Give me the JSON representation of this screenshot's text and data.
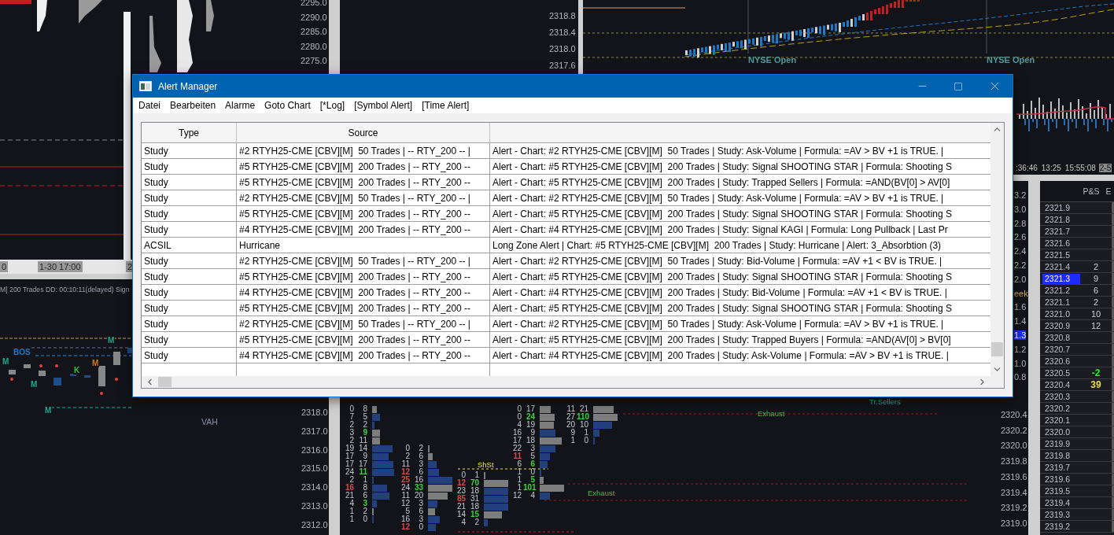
{
  "charts": {
    "top_left": {
      "price_axis": [
        "2295.0",
        "2290.0",
        "2285.0",
        "2280.0",
        "2275.0"
      ],
      "time_axis": [
        "0",
        "1-30 17:00",
        "2"
      ]
    },
    "top_middle": {
      "price_axis": [
        "2318.8",
        "2318.4",
        "2318.0",
        "2317.6"
      ]
    },
    "top_right": {
      "markers": [
        "NYSE Open",
        "NYSE Open"
      ],
      "time_axis": [
        ":36:46",
        "13:25",
        "15:55:08",
        "2-5"
      ]
    },
    "left_middle": {
      "header": "M] 200 Trades DD: 00:10:11(delayed) Sign",
      "labels": [
        {
          "text": "BOS",
          "color": "#1e78c8"
        },
        {
          "text": "M",
          "color": "#1aa88a"
        },
        {
          "text": "M",
          "color": "#1aa88a"
        },
        {
          "text": "M",
          "color": "#1aa88a"
        },
        {
          "text": "K",
          "color": "#32c832"
        },
        {
          "text": "M",
          "color": "#d2781e"
        },
        {
          "text": "M",
          "color": "#1aa88a"
        }
      ],
      "level_label": "VAH",
      "price_axis": [
        "2318.0",
        "2317.0",
        "2316.0",
        "2315.0",
        "2314.0",
        "2313.0",
        "2312.0"
      ]
    },
    "footprint": {
      "columns": [
        {
          "rows": [
            {
              "cells": [
                {
                  "text": "0"
                },
                {
                  "text": "8"
                }
              ]
            },
            {
              "cells": [
                {
                  "text": "7"
                },
                {
                  "text": "5"
                }
              ]
            },
            {
              "cells": [
                {
                  "text": "2"
                },
                {
                  "text": "2"
                }
              ]
            },
            {
              "cells": [
                {
                  "text": "3"
                },
                {
                  "text": "9",
                  "color": "#3cd23c"
                }
              ]
            },
            {
              "cells": [
                {
                  "text": "2"
                },
                {
                  "text": "11"
                }
              ]
            },
            {
              "cells": [
                {
                  "text": "19"
                },
                {
                  "text": "14"
                }
              ]
            },
            {
              "cells": [
                {
                  "text": "17"
                },
                {
                  "text": "9"
                }
              ]
            },
            {
              "cells": [
                {
                  "text": "17"
                },
                {
                  "text": "17"
                }
              ]
            },
            {
              "cells": [
                {
                  "text": "24"
                },
                {
                  "text": "11",
                  "color": "#3cd23c"
                }
              ]
            },
            {
              "cells": [
                {
                  "text": "2"
                },
                {
                  "text": "1"
                }
              ]
            },
            {
              "cells": [
                {
                  "text": "16",
                  "color": "#d94a4a"
                },
                {
                  "text": "8"
                }
              ]
            },
            {
              "cells": [
                {
                  "text": "21"
                },
                {
                  "text": "6"
                }
              ]
            },
            {
              "cells": [
                {
                  "text": "4"
                },
                {
                  "text": "3",
                  "color": "#3cd23c"
                }
              ]
            },
            {
              "cells": [
                {
                  "text": "1"
                },
                {
                  "text": "2"
                }
              ]
            },
            {
              "cells": [
                {
                  "text": "1"
                },
                {
                  "text": "0"
                }
              ]
            }
          ]
        },
        {
          "rows": [
            {
              "cells": [
                {
                  "text": "0"
                },
                {
                  "text": "2"
                }
              ]
            },
            {
              "cells": [
                {
                  "text": "2"
                },
                {
                  "text": "6"
                }
              ]
            },
            {
              "cells": [
                {
                  "text": "11"
                },
                {
                  "text": "3"
                }
              ]
            },
            {
              "cells": [
                {
                  "text": "12",
                  "color": "#d94a4a"
                },
                {
                  "text": "6"
                }
              ]
            },
            {
              "cells": [
                {
                  "text": "25",
                  "color": "#d94a4a"
                },
                {
                  "text": "16"
                }
              ]
            },
            {
              "cells": [
                {
                  "text": "24"
                },
                {
                  "text": "33",
                  "color": "#3cd23c"
                }
              ]
            },
            {
              "cells": [
                {
                  "text": "11"
                },
                {
                  "text": "20"
                }
              ]
            },
            {
              "cells": [
                {
                  "text": "12"
                },
                {
                  "text": "3"
                }
              ]
            },
            {
              "cells": [
                {
                  "text": "5"
                },
                {
                  "text": "6"
                }
              ]
            },
            {
              "cells": [
                {
                  "text": "16"
                },
                {
                  "text": "3"
                }
              ]
            },
            {
              "cells": [
                {
                  "text": "12",
                  "color": "#d94a4a"
                },
                {
                  "text": "0"
                }
              ]
            }
          ]
        },
        {
          "label": "ShSt",
          "rows": [
            {
              "cells": [
                {
                  "text": "0"
                },
                {
                  "text": "1"
                }
              ]
            },
            {
              "cells": [
                {
                  "text": "12",
                  "color": "#d94a4a"
                },
                {
                  "text": "70",
                  "color": "#3cd23c"
                }
              ]
            },
            {
              "cells": [
                {
                  "text": "23"
                },
                {
                  "text": "18"
                }
              ]
            },
            {
              "cells": [
                {
                  "text": "85",
                  "color": "#d94a4a"
                },
                {
                  "text": "31"
                }
              ]
            },
            {
              "cells": [
                {
                  "text": "21"
                },
                {
                  "text": "18"
                }
              ]
            },
            {
              "cells": [
                {
                  "text": "14"
                },
                {
                  "text": "15",
                  "color": "#3cd23c"
                }
              ]
            },
            {
              "cells": [
                {
                  "text": "4"
                },
                {
                  "text": "2"
                }
              ]
            }
          ]
        },
        {
          "rows": [
            {
              "cells": [
                {
                  "text": "0"
                },
                {
                  "text": "17"
                }
              ]
            },
            {
              "cells": [
                {
                  "text": "0"
                },
                {
                  "text": "24",
                  "color": "#3cd23c"
                }
              ]
            },
            {
              "cells": [
                {
                  "text": "4"
                },
                {
                  "text": "19"
                }
              ]
            },
            {
              "cells": [
                {
                  "text": "16"
                },
                {
                  "text": "9"
                }
              ]
            },
            {
              "cells": [
                {
                  "text": "17"
                },
                {
                  "text": "18"
                }
              ]
            },
            {
              "cells": [
                {
                  "text": "22"
                },
                {
                  "text": "3"
                }
              ]
            },
            {
              "cells": [
                {
                  "text": "11",
                  "color": "#d94a4a"
                },
                {
                  "text": "5"
                }
              ]
            },
            {
              "cells": [
                {
                  "text": "6"
                },
                {
                  "text": "6",
                  "color": "#3cd23c"
                }
              ]
            },
            {
              "cells": [
                {
                  "text": "1"
                },
                {
                  "text": "0"
                }
              ]
            },
            {
              "cells": [
                {
                  "text": "1"
                },
                {
                  "text": "5",
                  "color": "#3cd23c"
                }
              ]
            },
            {
              "cells": [
                {
                  "text": "1"
                },
                {
                  "text": "101",
                  "color": "#3cd23c"
                }
              ]
            },
            {
              "cells": [
                {
                  "text": "12"
                },
                {
                  "text": "4"
                }
              ]
            }
          ]
        },
        {
          "rows": [
            {
              "cells": [
                {
                  "text": "11"
                },
                {
                  "text": "21"
                }
              ]
            },
            {
              "cells": [
                {
                  "text": "27"
                },
                {
                  "text": "110",
                  "color": "#3cd23c"
                }
              ]
            },
            {
              "cells": [
                {
                  "text": "20"
                },
                {
                  "text": "10"
                }
              ]
            },
            {
              "cells": [
                {
                  "text": "9"
                },
                {
                  "text": "1"
                }
              ]
            },
            {
              "cells": [
                {
                  "text": "1"
                },
                {
                  "text": "0"
                }
              ]
            }
          ]
        }
      ],
      "labels": [
        "Exhaust",
        "Exhaust",
        "Tr.Sellers"
      ],
      "axis_tails": [
        {
          "text": "3.2",
          "highlighted": false
        },
        {
          "text": "3.0",
          "highlighted": false
        },
        {
          "text": "2.8",
          "highlighted": false
        },
        {
          "text": "2.6",
          "highlighted": false
        },
        {
          "text": "2.4",
          "highlighted": false
        },
        {
          "text": "2.2",
          "highlighted": false
        },
        {
          "text": "2.0",
          "highlighted": false
        },
        {
          "text": "eek",
          "highlighted": false
        },
        {
          "text": "1.6",
          "highlighted": false
        },
        {
          "text": "1.4",
          "highlighted": false
        },
        {
          "text": "1.3",
          "highlighted": true
        },
        {
          "text": "1.2",
          "highlighted": false
        },
        {
          "text": "1.0",
          "highlighted": false
        },
        {
          "text": "0.8",
          "highlighted": false
        }
      ],
      "price_axis": [
        "2320.4",
        "2320.2",
        "2320.0",
        "2319.8",
        "2319.6",
        "2319.4",
        "2319.2",
        "2319.0"
      ]
    },
    "dom": {
      "columns": [
        "P&S",
        "E"
      ],
      "rows": [
        {
          "price": "2321.9",
          "highlighted": false
        },
        {
          "price": "2321.8",
          "highlighted": false
        },
        {
          "price": "2321.7",
          "highlighted": false
        },
        {
          "price": "2321.6",
          "highlighted": false
        },
        {
          "price": "2321.5",
          "highlighted": false
        },
        {
          "price": "2321.4",
          "ps": "2",
          "highlighted": false
        },
        {
          "price": "2321.3",
          "ps": "9",
          "highlighted": true
        },
        {
          "price": "2321.2",
          "ps": "6",
          "highlighted": false
        },
        {
          "price": "2321.1",
          "ps": "2",
          "highlighted": false
        },
        {
          "price": "2321.0",
          "ps": "10",
          "highlighted": false
        },
        {
          "price": "2320.9",
          "ps": "12",
          "highlighted": false
        },
        {
          "price": "2320.8",
          "highlighted": false
        },
        {
          "price": "2320.7",
          "highlighted": false
        },
        {
          "price": "2320.6",
          "highlighted": false
        },
        {
          "price": "2320.5",
          "ps": "-2",
          "color": "#2ee82e",
          "highlighted": false
        },
        {
          "price": "2320.4",
          "ps": "39",
          "color": "#e8d84a",
          "highlighted": false
        },
        {
          "price": "2320.3",
          "highlighted": false
        },
        {
          "price": "2320.2",
          "highlighted": false
        },
        {
          "price": "2320.1",
          "highlighted": false
        },
        {
          "price": "2320.0",
          "highlighted": false
        },
        {
          "price": "2319.9",
          "highlighted": false
        },
        {
          "price": "2319.8",
          "highlighted": false
        },
        {
          "price": "2319.7",
          "highlighted": false
        },
        {
          "price": "2319.6",
          "highlighted": false
        },
        {
          "price": "2319.5",
          "highlighted": false
        },
        {
          "price": "2319.4",
          "highlighted": false
        },
        {
          "price": "2319.3",
          "highlighted": false
        },
        {
          "price": "2319.2",
          "highlighted": false
        }
      ]
    }
  },
  "window": {
    "title": "Alert Manager",
    "menu": [
      "Datei",
      "Bearbeiten",
      "Alarme",
      "Goto Chart",
      "[*Log]",
      "[Symbol Alert]",
      "[Time Alert]"
    ],
    "table": {
      "columns": [
        "Type",
        "Source"
      ],
      "rows": [
        {
          "type": "Study",
          "source": "#2 RTYH25-CME [CBV][M]  50 Trades | -- RTY_200 -- |",
          "message": "Alert - Chart: #2 RTYH25-CME [CBV][M]  50 Trades | Study: Ask-Volume | Formula: =AV > BV +1 is TRUE. |"
        },
        {
          "type": "Study",
          "source": "#5 RTYH25-CME [CBV][M]  200 Trades | -- RTY_200 --",
          "message": "Alert - Chart: #5 RTYH25-CME [CBV][M]  200 Trades | Study: Signal SHOOTING STAR | Formula: Shooting S"
        },
        {
          "type": "Study",
          "source": "#5 RTYH25-CME [CBV][M]  200 Trades | -- RTY_200 --",
          "message": "Alert - Chart: #5 RTYH25-CME [CBV][M]  200 Trades | Study: Trapped Sellers | Formula: =AND(BV[0] > AV[0]"
        },
        {
          "type": "Study",
          "source": "#2 RTYH25-CME [CBV][M]  50 Trades | -- RTY_200 -- |",
          "message": "Alert - Chart: #2 RTYH25-CME [CBV][M]  50 Trades | Study: Ask-Volume | Formula: =AV > BV +1 is TRUE. |"
        },
        {
          "type": "Study",
          "source": "#5 RTYH25-CME [CBV][M]  200 Trades | -- RTY_200 --",
          "message": "Alert - Chart: #5 RTYH25-CME [CBV][M]  200 Trades | Study: Signal SHOOTING STAR | Formula: Shooting S"
        },
        {
          "type": "Study",
          "source": "#4 RTYH25-CME [CBV][M]  200 Trades | -- RTY_200 --",
          "message": "Alert - Chart: #4 RTYH25-CME [CBV][M]  200 Trades | Study: Signal KAGI | Formula: Long Pullback | Last Pr"
        },
        {
          "type": "ACSIL",
          "source": "Hurricane",
          "message": "Long Zone Alert | Chart: #5 RTYH25-CME [CBV][M]  200 Trades | Study: Hurricane | Alert: 3_Absorbtion (3)"
        },
        {
          "type": "Study",
          "source": "#2 RTYH25-CME [CBV][M]  50 Trades | -- RTY_200 -- |",
          "message": "Alert - Chart: #2 RTYH25-CME [CBV][M]  50 Trades | Study: Bid-Volume | Formula: =AV +1 < BV is TRUE. |"
        },
        {
          "type": "Study",
          "source": "#5 RTYH25-CME [CBV][M]  200 Trades | -- RTY_200 --",
          "message": "Alert - Chart: #5 RTYH25-CME [CBV][M]  200 Trades | Study: Signal SHOOTING STAR | Formula: Shooting S"
        },
        {
          "type": "Study",
          "source": "#4 RTYH25-CME [CBV][M]  200 Trades | -- RTY_200 --",
          "message": "Alert - Chart: #4 RTYH25-CME [CBV][M]  200 Trades | Study: Bid-Volume | Formula: =AV +1 < BV is TRUE. |"
        },
        {
          "type": "Study",
          "source": "#5 RTYH25-CME [CBV][M]  200 Trades | -- RTY_200 --",
          "message": "Alert - Chart: #5 RTYH25-CME [CBV][M]  200 Trades | Study: Signal SHOOTING STAR | Formula: Shooting S"
        },
        {
          "type": "Study",
          "source": "#2 RTYH25-CME [CBV][M]  50 Trades | -- RTY_200 -- |",
          "message": "Alert - Chart: #2 RTYH25-CME [CBV][M]  50 Trades | Study: Ask-Volume | Formula: =AV > BV +1 is TRUE. |"
        },
        {
          "type": "Study",
          "source": "#5 RTYH25-CME [CBV][M]  200 Trades | -- RTY_200 --",
          "message": "Alert - Chart: #5 RTYH25-CME [CBV][M]  200 Trades | Study: Trapped Buyers | Formula: =AND(AV[0] > BV[0]"
        },
        {
          "type": "Study",
          "source": "#4 RTYH25-CME [CBV][M]  200 Trades | -- RTY_200 --",
          "message": "Alert - Chart: #4 RTYH25-CME [CBV][M]  200 Trades | Study: Ask-Volume | Formula: =AV > BV +1 is TRUE. |"
        }
      ]
    }
  }
}
